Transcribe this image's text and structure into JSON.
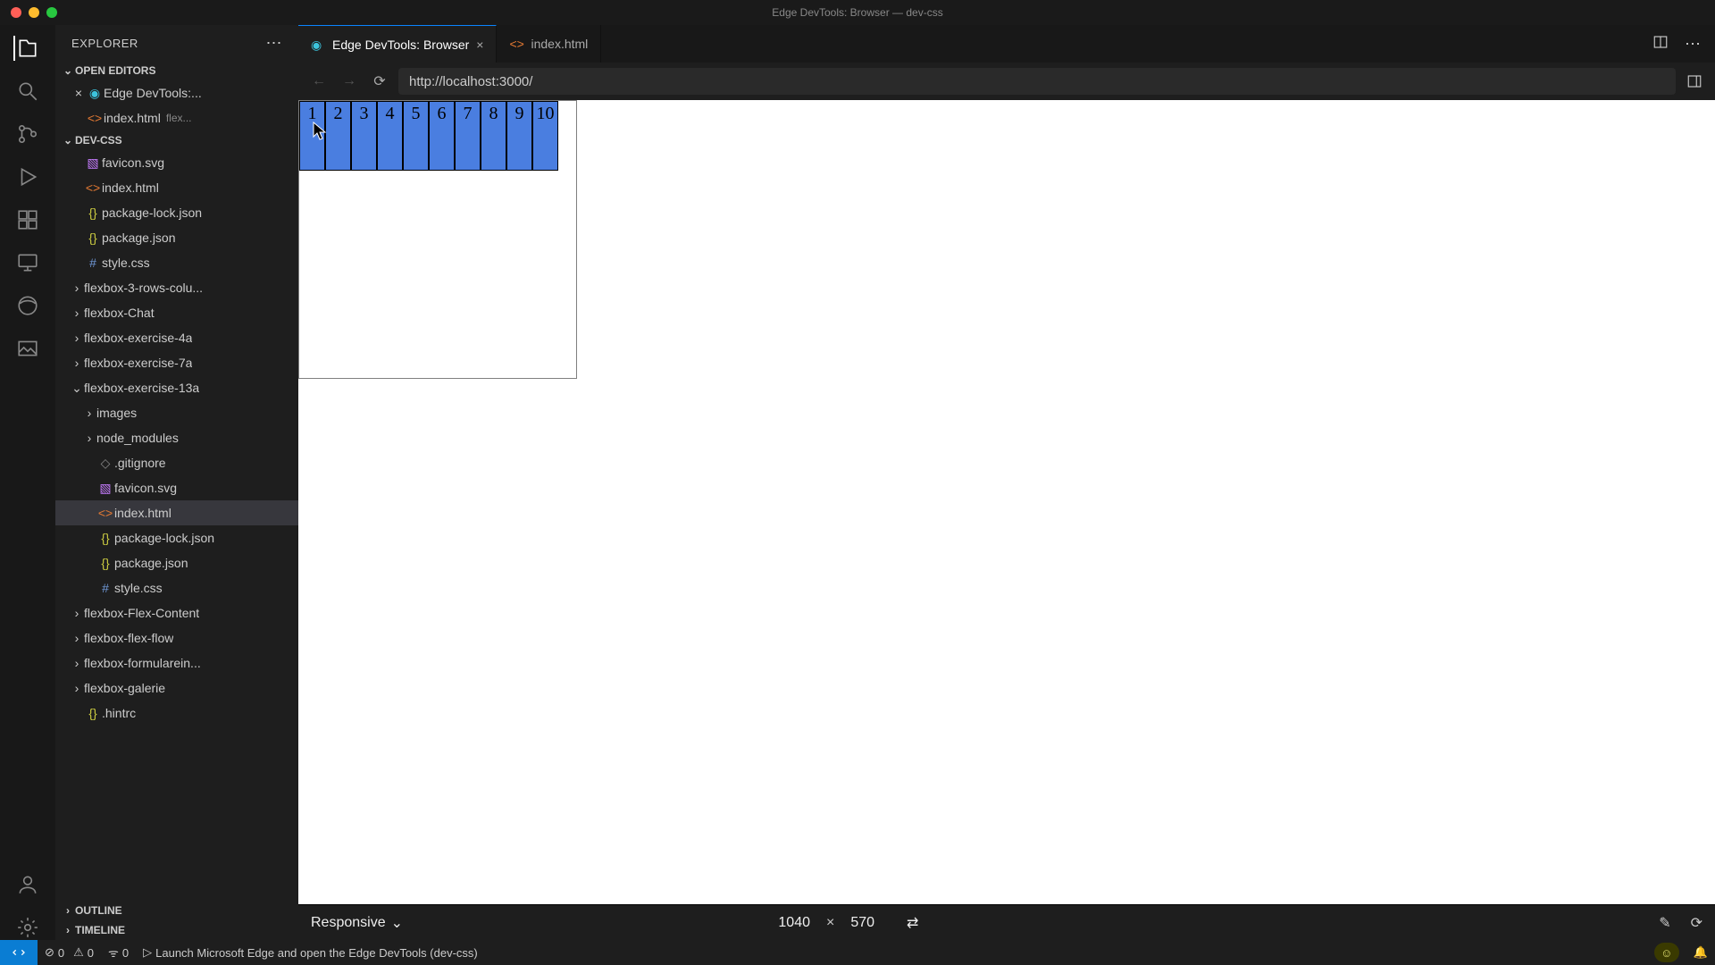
{
  "window": {
    "title": "Edge DevTools: Browser — dev-css"
  },
  "explorer": {
    "title": "EXPLORER",
    "open_editors_label": "OPEN EDITORS",
    "project_label": "DEV-CSS",
    "outline_label": "OUTLINE",
    "timeline_label": "TIMELINE",
    "open_editors": [
      {
        "label": "Edge DevTools:...",
        "icon": "edge",
        "close": true
      },
      {
        "label": "index.html",
        "icon": "html",
        "meta": "flex..."
      }
    ],
    "tree": [
      {
        "depth": 0,
        "folder": false,
        "icon": "svg",
        "label": "favicon.svg"
      },
      {
        "depth": 0,
        "folder": false,
        "icon": "html",
        "label": "index.html"
      },
      {
        "depth": 0,
        "folder": false,
        "icon": "json",
        "label": "package-lock.json"
      },
      {
        "depth": 0,
        "folder": false,
        "icon": "json",
        "label": "package.json"
      },
      {
        "depth": 0,
        "folder": false,
        "icon": "css",
        "label": "style.css"
      },
      {
        "depth": 0,
        "folder": true,
        "open": false,
        "label": "flexbox-3-rows-colu..."
      },
      {
        "depth": 0,
        "folder": true,
        "open": false,
        "label": "flexbox-Chat"
      },
      {
        "depth": 0,
        "folder": true,
        "open": false,
        "label": "flexbox-exercise-4a"
      },
      {
        "depth": 0,
        "folder": true,
        "open": false,
        "label": "flexbox-exercise-7a"
      },
      {
        "depth": 0,
        "folder": true,
        "open": true,
        "label": "flexbox-exercise-13a"
      },
      {
        "depth": 1,
        "folder": true,
        "open": false,
        "label": "images"
      },
      {
        "depth": 1,
        "folder": true,
        "open": false,
        "label": "node_modules"
      },
      {
        "depth": 1,
        "folder": false,
        "icon": "git",
        "label": ".gitignore"
      },
      {
        "depth": 1,
        "folder": false,
        "icon": "svg",
        "label": "favicon.svg"
      },
      {
        "depth": 1,
        "folder": false,
        "icon": "html",
        "label": "index.html",
        "selected": true
      },
      {
        "depth": 1,
        "folder": false,
        "icon": "json",
        "label": "package-lock.json"
      },
      {
        "depth": 1,
        "folder": false,
        "icon": "json",
        "label": "package.json"
      },
      {
        "depth": 1,
        "folder": false,
        "icon": "css",
        "label": "style.css"
      },
      {
        "depth": 0,
        "folder": true,
        "open": false,
        "label": "flexbox-Flex-Content"
      },
      {
        "depth": 0,
        "folder": true,
        "open": false,
        "label": "flexbox-flex-flow"
      },
      {
        "depth": 0,
        "folder": true,
        "open": false,
        "label": "flexbox-formularein..."
      },
      {
        "depth": 0,
        "folder": true,
        "open": false,
        "label": "flexbox-galerie"
      },
      {
        "depth": 0,
        "folder": false,
        "icon": "json",
        "label": ".hintrc"
      }
    ]
  },
  "tabs": [
    {
      "label": "Edge DevTools: Browser",
      "icon": "edge",
      "active": true
    },
    {
      "label": "index.html",
      "icon": "html",
      "active": false
    }
  ],
  "url": "http://localhost:3000/",
  "flex_items": [
    "1",
    "2",
    "3",
    "4",
    "5",
    "6",
    "7",
    "8",
    "9",
    "10"
  ],
  "device": {
    "mode": "Responsive",
    "width": "1040",
    "height": "570"
  },
  "status": {
    "errors": "0",
    "warnings": "0",
    "ports": "0",
    "launch": "Launch Microsoft Edge and open the Edge DevTools (dev-css)"
  }
}
